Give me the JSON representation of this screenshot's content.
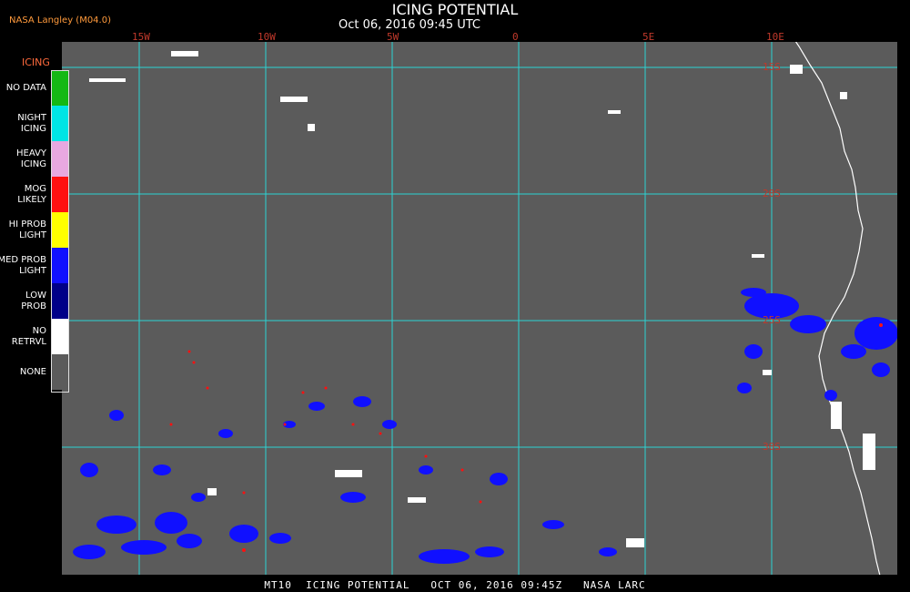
{
  "header": {
    "title": "ICING POTENTIAL",
    "subtitle": "Oct 06, 2016 09:45 UTC",
    "credit": "NASA Langley (M04.0)"
  },
  "grid": {
    "longitudes": [
      "15W",
      "10W",
      "5W",
      "0",
      "5E",
      "10E"
    ],
    "latitudes": [
      "15S",
      "20S",
      "25S",
      "30S"
    ]
  },
  "legend": {
    "title": "ICING",
    "items": [
      {
        "label": "NO DATA",
        "color": "#14b814"
      },
      {
        "label": "NIGHT\nICING",
        "color": "#00e5e5"
      },
      {
        "label": "HEAVY\nICING",
        "color": "#e8a8e0"
      },
      {
        "label": "MOG\nLIKELY",
        "color": "#ff1010"
      },
      {
        "label": "HI PROB\nLIGHT",
        "color": "#ffff00"
      },
      {
        "label": "MED PROB\nLIGHT",
        "color": "#1010ff"
      },
      {
        "label": "LOW\nPROB",
        "color": "#000088"
      },
      {
        "label": "NO\nRETRVL",
        "color": "#ffffff"
      },
      {
        "label": "NONE",
        "color": "#5b5b5b"
      }
    ]
  },
  "footer": "MT10  ICING POTENTIAL   OCT 06, 2016 09:45Z   NASA LARC",
  "colors": {
    "grid": "#2bd3d3",
    "background": "#5b5b5b",
    "coast": "#ffffff"
  }
}
